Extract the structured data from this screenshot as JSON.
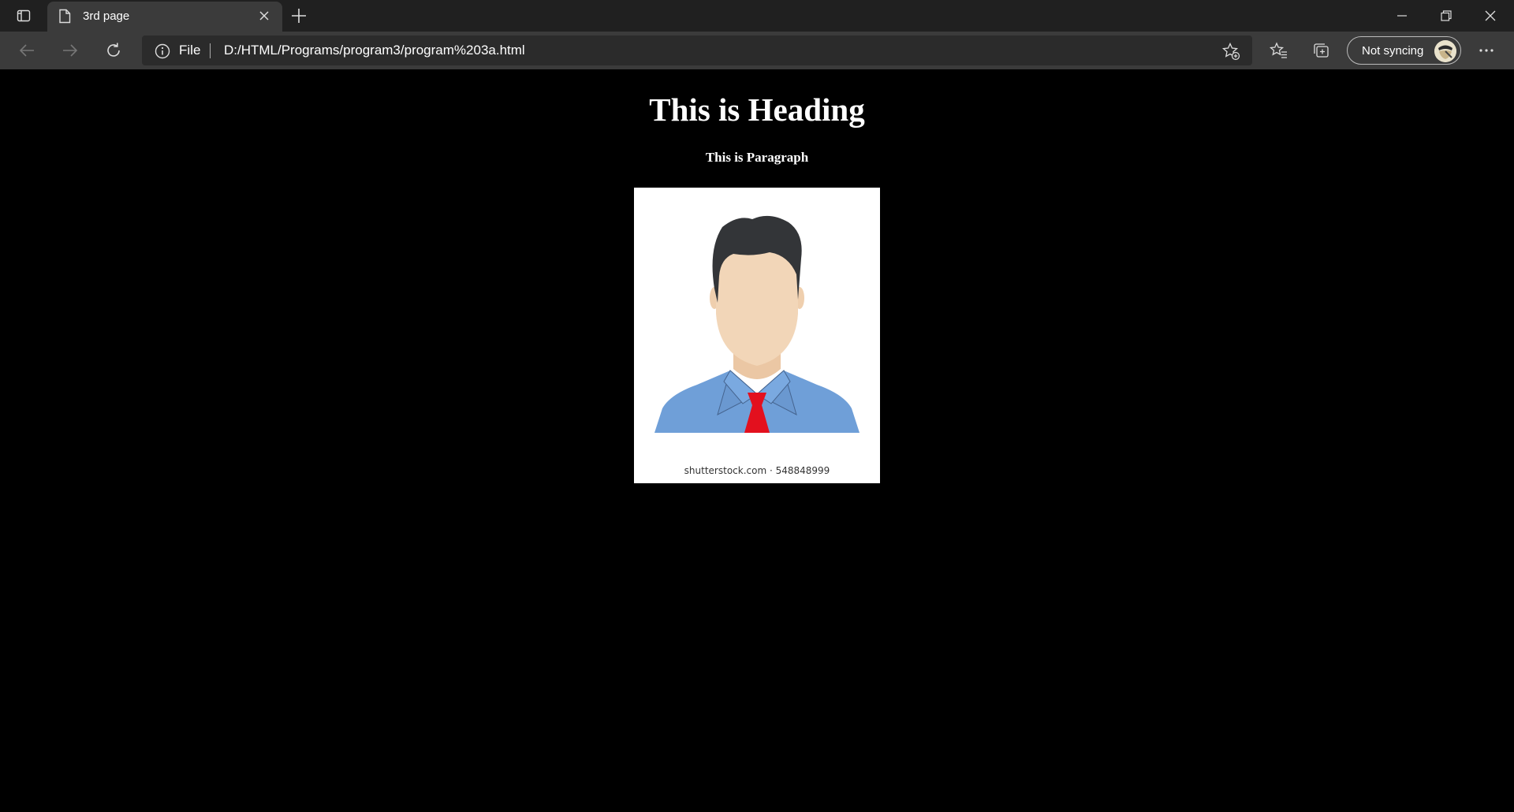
{
  "tab": {
    "title": "3rd page"
  },
  "address_bar": {
    "scheme": "File",
    "url": "D:/HTML/Programs/program3/program%203a.html"
  },
  "profile": {
    "sync_label": "Not syncing"
  },
  "page": {
    "heading": "This is Heading",
    "paragraph": "This is Paragraph",
    "image": {
      "credit": "shutterstock.com · 548848999",
      "tie_color": "#e3101e",
      "shirt_color": "#6f9fd8",
      "skin_color": "#f2d6b8",
      "hair_color": "#333538"
    }
  },
  "icons": [
    "tab-actions-icon",
    "page-icon",
    "close-tab-icon",
    "new-tab-icon",
    "minimize-icon",
    "restore-icon",
    "close-window-icon",
    "back-icon",
    "forward-icon",
    "refresh-icon",
    "info-icon",
    "add-favorite-icon",
    "favorites-icon",
    "collections-icon",
    "more-icon"
  ]
}
